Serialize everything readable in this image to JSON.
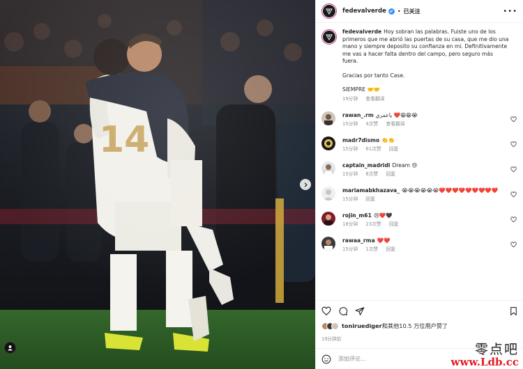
{
  "post": {
    "username": "fedevalverde",
    "follow_state": "已关注",
    "separator": "•"
  },
  "caption": {
    "username": "fedevalverde",
    "para1": "Hoy sobran las palabras. Fuiste uno de los primeros que me abrió las puertas de su casa, que me dio una mano y siempre deposito su confianza en mi. Definitivamente me vas a hacer falta dentro del campo, pero seguro más fuera.",
    "para2": "Gracias por tanto Case.",
    "para3": "SIEMPRE 🤝🤝",
    "time": "19分钟",
    "translate": "查看翻译"
  },
  "comments": [
    {
      "username": "rawan_.rm",
      "text": "ياعمري ❤️😁😁😭",
      "time": "15分钟",
      "likes": "4次赞",
      "reply": "回复",
      "extra": "查看翻译"
    },
    {
      "username": "madr7dismo",
      "text": "👏👏",
      "time": "15分钟",
      "likes": "61次赞",
      "reply": "回复",
      "extra": ""
    },
    {
      "username": "captain_madridi",
      "text": "Dream 😢",
      "time": "15分钟",
      "likes": "8次赞",
      "reply": "回复",
      "extra": ""
    },
    {
      "username": "mariamabkhazava_",
      "text": "😭😭😭😭😭😭❤️❤️❤️❤️❤️❤️❤️❤️❤️",
      "time": "15分钟",
      "likes": "",
      "reply": "回复",
      "extra": ""
    },
    {
      "username": "rojin_m61",
      "text": "😢❤️🖤",
      "time": "18分钟",
      "likes": "23次赞",
      "reply": "回复",
      "extra": ""
    },
    {
      "username": "rawaa_rma",
      "text": "❤️❤️",
      "time": "15分钟",
      "likes": "1次赞",
      "reply": "回复",
      "extra": ""
    }
  ],
  "likes": {
    "user": "toniruediger",
    "text": "和其他10.5 万位用户赞了"
  },
  "posted_time": "19分钟前",
  "add_comment": {
    "placeholder": "添加评论..."
  },
  "watermark": {
    "zh": "零点吧",
    "url": "www.Ldb.cc"
  },
  "colors": {
    "accent_blue": "#3897f0",
    "heart_red": "#ed4956",
    "watermark_red": "#e31b23",
    "meta_gray": "#8e8e8e"
  },
  "icons": {
    "like": "heart-icon",
    "comment": "comment-icon",
    "share": "share-icon",
    "save": "bookmark-icon",
    "emoji": "emoji-icon",
    "more": "more-icon",
    "verified": "verified-badge-icon",
    "carousel": "chevron-right-icon",
    "tagged": "tagged-user-icon"
  }
}
